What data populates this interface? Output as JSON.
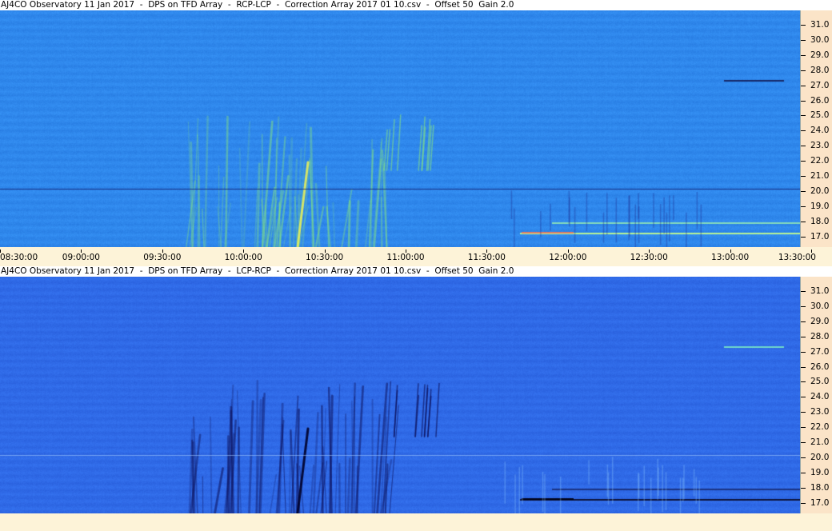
{
  "panels": [
    {
      "title": "AJ4CO Observatory 11 Jan 2017  -  DPS on TFD Array  -  RCP-LCP  -  Correction Array 2017 01 10.csv  -  Offset 50  Gain 2.0",
      "mode": "bright",
      "y_ticks": [
        "31.0",
        "30.0",
        "29.0",
        "28.0",
        "27.0",
        "26.0",
        "25.0",
        "24.0",
        "23.0",
        "22.0",
        "21.0",
        "20.0",
        "19.0",
        "18.0",
        "17.0"
      ],
      "x_ticks": [
        "08:30:00",
        "09:00:00",
        "09:30:00",
        "10:00:00",
        "10:30:00",
        "11:00:00",
        "11:30:00",
        "12:00:00",
        "12:30:00",
        "13:00:00",
        "13:30:00"
      ]
    },
    {
      "title": "AJ4CO Observatory 11 Jan 2017  -  DPS on TFD Array  -  LCP-RCP  -  Correction Array 2017 01 10.csv  -  Offset 50  Gain 2.0",
      "mode": "dark",
      "y_ticks": [
        "31.0",
        "30.0",
        "29.0",
        "28.0",
        "27.0",
        "26.0",
        "25.0",
        "24.0",
        "23.0",
        "22.0",
        "21.0",
        "20.0",
        "19.0",
        "18.0",
        "17.0"
      ],
      "x_ticks": []
    }
  ]
}
